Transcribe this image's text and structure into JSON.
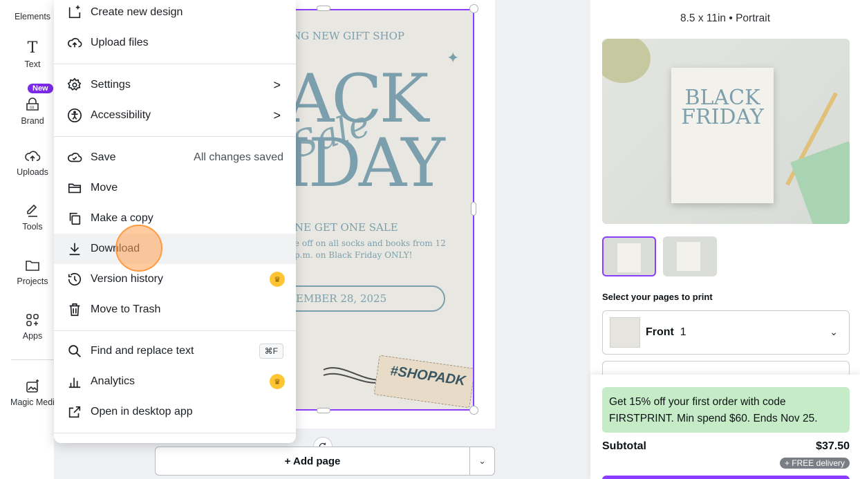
{
  "rail": {
    "items": [
      {
        "label": "Elements"
      },
      {
        "label": "Text"
      },
      {
        "label": "Brand"
      },
      {
        "label": "Uploads"
      },
      {
        "label": "Tools"
      },
      {
        "label": "Projects"
      },
      {
        "label": "Apps"
      },
      {
        "label": "Magic Medi"
      }
    ],
    "new_badge": "New"
  },
  "menu": {
    "items": [
      {
        "label": "Create new design",
        "icon": "add-design-icon"
      },
      {
        "label": "Upload files",
        "icon": "upload-icon"
      },
      {
        "label": "Settings",
        "icon": "gear-icon",
        "chevron": ">"
      },
      {
        "label": "Accessibility",
        "icon": "accessibility-icon",
        "chevron": ">"
      },
      {
        "label": "Save",
        "icon": "cloud-check-icon",
        "right": "All changes saved"
      },
      {
        "label": "Move",
        "icon": "folder-icon"
      },
      {
        "label": "Make a copy",
        "icon": "copy-icon"
      },
      {
        "label": "Download",
        "icon": "download-icon"
      },
      {
        "label": "Version history",
        "icon": "history-icon"
      },
      {
        "label": "Move to Trash",
        "icon": "trash-icon"
      },
      {
        "label": "Find and replace text",
        "icon": "search-icon",
        "shortcut": "⌘F"
      },
      {
        "label": "Analytics",
        "icon": "analytics-icon"
      },
      {
        "label": "Open in desktop app",
        "icon": "external-link-icon"
      }
    ]
  },
  "design": {
    "shop": "NG NEW GIFT SHOP",
    "black": "ACK",
    "friday": "IDAY",
    "sale": "Sale",
    "bogo": "NE GET ONE SALE",
    "desc1": "e off on all socks and books from 12",
    "desc2": "p.m. on Black Friday ONLY!",
    "date": "EMBER 28, 2025",
    "tag": "#SHOPADK"
  },
  "canvas": {
    "add_page": "+ Add page"
  },
  "panel": {
    "size": "8.5 x 11in • Portrait",
    "flyer_title": "BLACK FRIDAY",
    "select_label": "Select your pages to print",
    "dropdown_name": "Front",
    "dropdown_count": "1",
    "promo": "Get 15% off your first order with code FIRSTPRINT. Min spend $60. Ends Nov 25.",
    "subtotal_label": "Subtotal",
    "subtotal_value": "$37.50",
    "free_delivery": "+ FREE delivery"
  },
  "colors": {
    "accent": "#8b3dff",
    "promo_bg": "#c5ecc6",
    "design_text": "#7c9fad",
    "crown": "#ffc533"
  }
}
